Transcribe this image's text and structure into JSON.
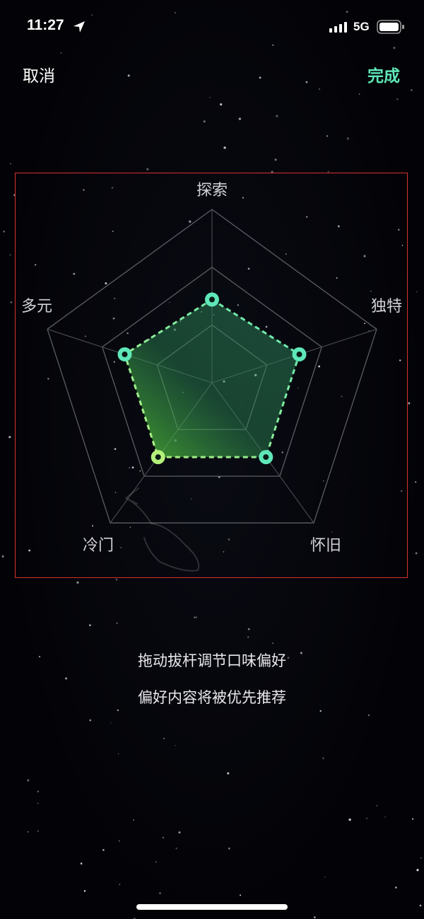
{
  "status_bar": {
    "time": "11:27",
    "network": "5G"
  },
  "nav": {
    "cancel_label": "取消",
    "done_label": "完成"
  },
  "colors": {
    "accent": "#5ee7b8",
    "accent_light": "#b4f07a",
    "frame_border": "#d8312d"
  },
  "chart_data": {
    "type": "radar",
    "axes": [
      "探索",
      "独特",
      "怀旧",
      "冷门",
      "多元"
    ],
    "levels": 3,
    "values": [
      0.48,
      0.53,
      0.53,
      0.53,
      0.53
    ],
    "range": [
      0,
      1
    ]
  },
  "instructions": {
    "line1": "拖动拔杆调节口味偏好",
    "line2": "偏好内容将被优先推荐"
  }
}
